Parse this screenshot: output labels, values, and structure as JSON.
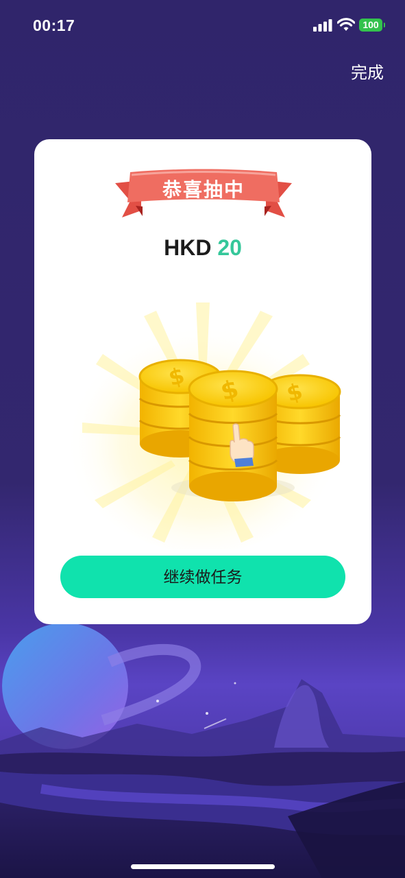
{
  "status_bar": {
    "time": "00:17",
    "battery": "100"
  },
  "header": {
    "done_label": "完成"
  },
  "dialog": {
    "banner_title": "恭喜抽中",
    "prize_currency": "HKD",
    "prize_amount": "20",
    "continue_label": "继续做任务"
  },
  "colors": {
    "background": "#30256b",
    "accent_green": "#10e2ad",
    "amount_green": "#35c79a",
    "ribbon_red": "#ec6b5e",
    "coin_gold": "#f6cc14"
  },
  "icons": [
    "signal-icon",
    "wifi-icon",
    "battery-icon",
    "coins-illustration",
    "tap-hand-icon",
    "planet-illustration"
  ]
}
